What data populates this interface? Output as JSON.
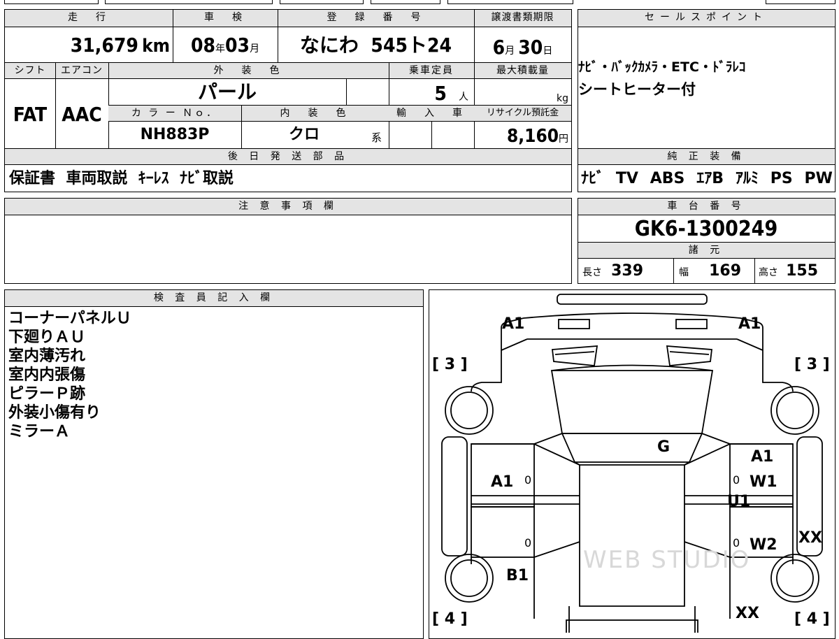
{
  "top": {
    "mileage": {
      "label": "走　行",
      "value": "31,679",
      "unit": "km"
    },
    "shaken": {
      "label": "車　検",
      "year": "08",
      "year_unit": "年",
      "month": "03",
      "month_unit": "月"
    },
    "plate": {
      "label": "登　録　番　号",
      "value": "なにわ  545ト24"
    },
    "transfer_deadline": {
      "label": "譲渡書類期限",
      "month": "6",
      "month_unit": "月",
      "day": "30",
      "day_unit": "日"
    }
  },
  "row2": {
    "shift": {
      "label": "シフト",
      "value": "FAT"
    },
    "aircon": {
      "label": "エアコン",
      "value": "AAC"
    },
    "exterior_color": {
      "label": "外　装　色",
      "value": "パール"
    },
    "capacity": {
      "label": "乗車定員",
      "value": "5",
      "unit": "人"
    },
    "max_load": {
      "label": "最大積載量",
      "value": "",
      "unit": "kg"
    },
    "color_no": {
      "label": "カ ラ ー Ｎｏ．",
      "value": "NH883P"
    },
    "interior_color": {
      "label": "内　装　色",
      "value": "クロ",
      "unit": "系"
    },
    "import": {
      "label": "輸　入　車",
      "value": ""
    },
    "recycle": {
      "label": "リサイクル預託金",
      "value": "8,160",
      "unit": "円"
    }
  },
  "later_items": {
    "label": "後 日 発 送 部 品",
    "value": "保証書  車両取説  ｷｰﾚｽ  ﾅﾋﾞ取説"
  },
  "sales_point": {
    "label": "セールスポイント",
    "lines": [
      "ﾅﾋﾞ・ﾊﾞｯｸｶﾒﾗ・ETC・ﾄﾞﾗﾚｺ",
      "シートヒーター付"
    ]
  },
  "standard_equipment": {
    "label": "純 正 装 備",
    "items": [
      "ﾅﾋﾞ",
      "TV",
      "ABS",
      "ｴｱB",
      "ｱﾙﾐ",
      "PS",
      "PW"
    ]
  },
  "notes": {
    "label": "注 意 事 項 欄",
    "value": ""
  },
  "chassis": {
    "label": "車 台 番 号",
    "value": "GK6-1300249"
  },
  "specs": {
    "label": "諸 元",
    "length_label": "長さ",
    "length": "339",
    "width_label": "幅",
    "width": "169",
    "height_label": "高さ",
    "height": "155"
  },
  "inspector": {
    "label": "検 査 員 記 入 欄",
    "lines": [
      "コーナーパネルＵ",
      "下廻りＡＵ",
      "室内薄汚れ",
      "室内内張傷",
      "ピラーＰ跡",
      "外装小傷有り",
      "ミラーＡ"
    ]
  },
  "diagram": {
    "marks": {
      "front_left": "A1",
      "front_right": "A1",
      "corner_fl": "[ 3 ]",
      "corner_fr": "[ 3 ]",
      "corner_rl": "[ 4 ]",
      "corner_rr": "[ 4 ]",
      "glass": "G",
      "door_left_front": "A1",
      "door_right_top": "A1",
      "w1": "W1",
      "u1": "U1",
      "w2": "W2",
      "rear_left": "B1",
      "xx_right": "XX",
      "xx_bottom": "XX",
      "zero": "0"
    },
    "watermark": "WEB STUDIO"
  }
}
